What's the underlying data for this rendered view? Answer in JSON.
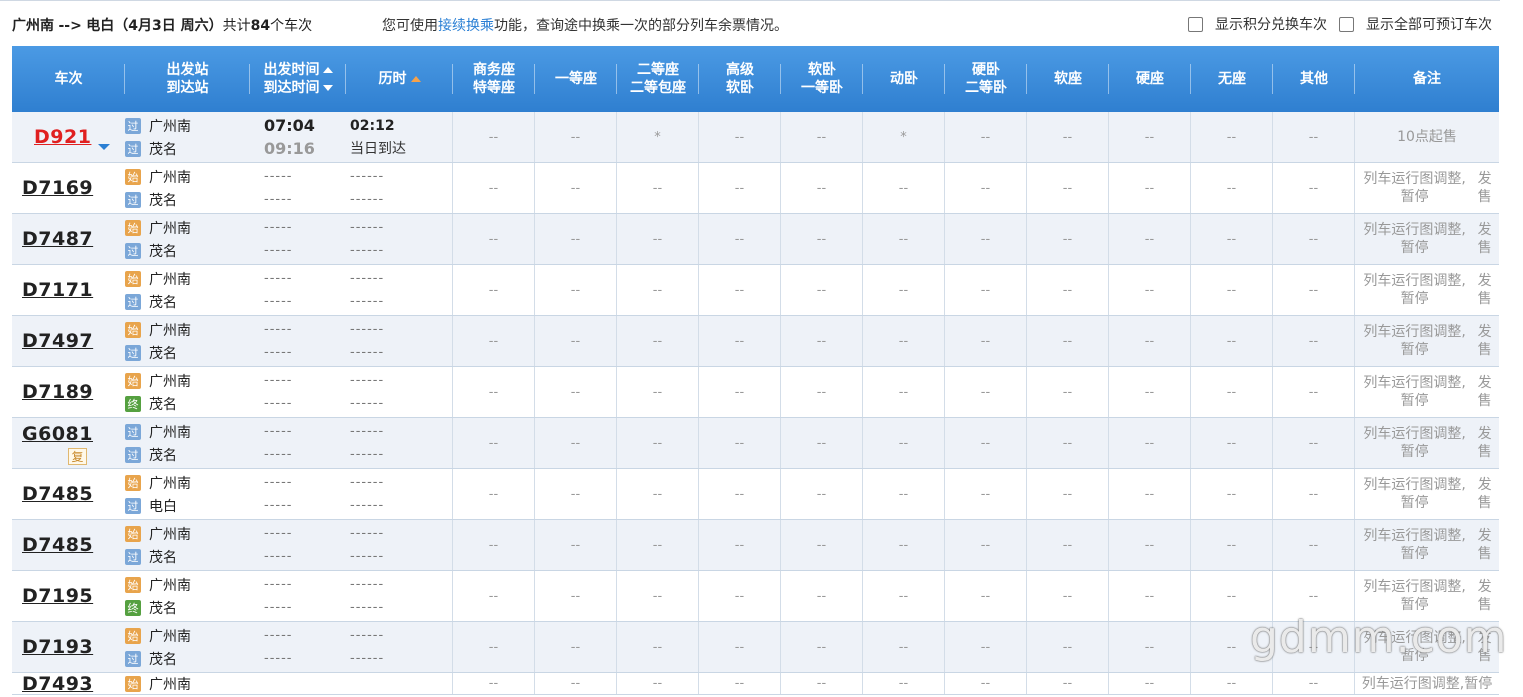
{
  "topbar": {
    "route_from": "广州南",
    "route_arrow": "-->",
    "route_to": "电白",
    "route_date": "（4月3日  周六）",
    "count_prefix": "共计",
    "count": "84",
    "count_suffix": "个车次",
    "tip_before": "您可使用",
    "tip_link": "接续换乘",
    "tip_after": "功能，查询途中换乘一次的部分列车余票情况。",
    "opt_points": "显示积分兑换车次",
    "opt_all": "显示全部可预订车次"
  },
  "headers": {
    "train": "车次",
    "station_top": "出发站",
    "station_bottom": "到达站",
    "time_top": "出发时间",
    "time_bottom": "到达时间",
    "duration": "历时",
    "biz_top": "商务座",
    "biz_bottom": "特等座",
    "first": "一等座",
    "second_top": "二等座",
    "second_bottom": "二等包座",
    "gaoji_top": "高级",
    "gaoji_bottom": "软卧",
    "ruanwo_top": "软卧",
    "ruanwo_bottom": "一等卧",
    "dongwo": "动卧",
    "yingwo_top": "硬卧",
    "yingwo_bottom": "二等卧",
    "ruanzuo": "软座",
    "yingzuo": "硬座",
    "wuzuo": "无座",
    "other": "其他",
    "note": "备注"
  },
  "badges": {
    "guo": "过",
    "shi": "始",
    "zhong": "终",
    "fu": "复"
  },
  "dash_short": "-----",
  "dash_long": "------",
  "cell_empty": "--",
  "cell_star": "*",
  "rows": [
    {
      "train": "D921",
      "red": true,
      "from_badge": "过",
      "from": "广州南",
      "to_badge": "过",
      "to": "茂名",
      "dep": "07:04",
      "arr": "09:16",
      "dur": "02:12",
      "dur_note": "当日到达",
      "seats": [
        "--",
        "--",
        "*",
        "--",
        "--",
        "*",
        "--",
        "--",
        "--",
        "--",
        "--"
      ],
      "note1": "10点起售",
      "note2": ""
    },
    {
      "train": "D7169",
      "from_badge": "始",
      "from": "广州南",
      "to_badge": "过",
      "to": "茂名",
      "seats": [
        "--",
        "--",
        "--",
        "--",
        "--",
        "--",
        "--",
        "--",
        "--",
        "--",
        "--"
      ],
      "note1": "列车运行图调整,暂停",
      "note2": "发售"
    },
    {
      "train": "D7487",
      "from_badge": "始",
      "from": "广州南",
      "to_badge": "过",
      "to": "茂名",
      "seats": [
        "--",
        "--",
        "--",
        "--",
        "--",
        "--",
        "--",
        "--",
        "--",
        "--",
        "--"
      ],
      "note1": "列车运行图调整,暂停",
      "note2": "发售"
    },
    {
      "train": "D7171",
      "from_badge": "始",
      "from": "广州南",
      "to_badge": "过",
      "to": "茂名",
      "seats": [
        "--",
        "--",
        "--",
        "--",
        "--",
        "--",
        "--",
        "--",
        "--",
        "--",
        "--"
      ],
      "note1": "列车运行图调整,暂停",
      "note2": "发售"
    },
    {
      "train": "D7497",
      "from_badge": "始",
      "from": "广州南",
      "to_badge": "过",
      "to": "茂名",
      "seats": [
        "--",
        "--",
        "--",
        "--",
        "--",
        "--",
        "--",
        "--",
        "--",
        "--",
        "--"
      ],
      "note1": "列车运行图调整,暂停",
      "note2": "发售"
    },
    {
      "train": "D7189",
      "from_badge": "始",
      "from": "广州南",
      "to_badge": "终",
      "to": "茂名",
      "seats": [
        "--",
        "--",
        "--",
        "--",
        "--",
        "--",
        "--",
        "--",
        "--",
        "--",
        "--"
      ],
      "note1": "列车运行图调整,暂停",
      "note2": "发售"
    },
    {
      "train": "G6081",
      "fu": true,
      "from_badge": "过",
      "from": "广州南",
      "to_badge": "过",
      "to": "茂名",
      "seats": [
        "--",
        "--",
        "--",
        "--",
        "--",
        "--",
        "--",
        "--",
        "--",
        "--",
        "--"
      ],
      "note1": "列车运行图调整,暂停",
      "note2": "发售"
    },
    {
      "train": "D7485",
      "from_badge": "始",
      "from": "广州南",
      "to_badge": "过",
      "to": "电白",
      "seats": [
        "--",
        "--",
        "--",
        "--",
        "--",
        "--",
        "--",
        "--",
        "--",
        "--",
        "--"
      ],
      "note1": "列车运行图调整,暂停",
      "note2": "发售"
    },
    {
      "train": "D7485",
      "from_badge": "始",
      "from": "广州南",
      "to_badge": "过",
      "to": "茂名",
      "seats": [
        "--",
        "--",
        "--",
        "--",
        "--",
        "--",
        "--",
        "--",
        "--",
        "--",
        "--"
      ],
      "note1": "列车运行图调整,暂停",
      "note2": "发售"
    },
    {
      "train": "D7195",
      "from_badge": "始",
      "from": "广州南",
      "to_badge": "终",
      "to": "茂名",
      "seats": [
        "--",
        "--",
        "--",
        "--",
        "--",
        "--",
        "--",
        "--",
        "--",
        "--",
        "--"
      ],
      "note1": "列车运行图调整,暂停",
      "note2": "发售"
    },
    {
      "train": "D7193",
      "from_badge": "始",
      "from": "广州南",
      "to_badge": "过",
      "to": "茂名",
      "seats": [
        "--",
        "--",
        "--",
        "--",
        "--",
        "--",
        "--",
        "--",
        "--",
        "--",
        "--"
      ],
      "note1": "列车运行图调整,暂停",
      "note2": "发售"
    },
    {
      "train": "D7493",
      "from_badge": "始",
      "from": "广州南",
      "to_badge": "",
      "to": "",
      "seats": [
        "--",
        "--",
        "--",
        "--",
        "--",
        "--",
        "--",
        "--",
        "--",
        "--",
        "--"
      ],
      "note1": "列车运行图调整,暂停",
      "note2": ""
    }
  ],
  "watermark": "gdmm.com",
  "colors": {
    "header_blue": "#3a8ad8",
    "train_red": "#e02020",
    "link_blue": "#2a7fd4",
    "row_alt": "#eef2f8"
  }
}
